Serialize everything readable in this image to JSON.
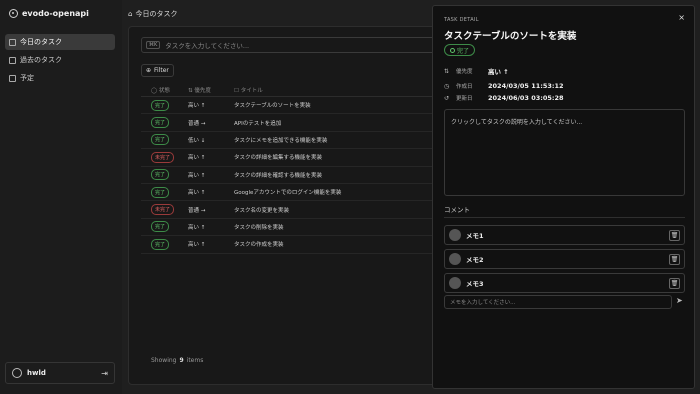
{
  "app": {
    "name": "evodo-openapi"
  },
  "sidebar": {
    "items": [
      {
        "label": "今日のタスク",
        "active": true
      },
      {
        "label": "過去のタスク",
        "active": false
      },
      {
        "label": "予定",
        "active": false
      }
    ],
    "user": {
      "name": "hwld"
    }
  },
  "header": {
    "title": "今日のタスク"
  },
  "main": {
    "search": {
      "shortcut": "⌘K",
      "placeholder": "タスクを入力してください..."
    },
    "filter_label": "Filter",
    "columns": {
      "status": "状態",
      "priority": "優先度",
      "title": "タイトル"
    },
    "rows": [
      {
        "status": "完了",
        "done": true,
        "priority": "高い",
        "arrow": "↑",
        "title": "タスクテーブルのソートを実装"
      },
      {
        "status": "完了",
        "done": true,
        "priority": "普通",
        "arrow": "→",
        "title": "APIのテストを追加"
      },
      {
        "status": "完了",
        "done": true,
        "priority": "低い",
        "arrow": "↓",
        "title": "タスクにメモを追加できる機能を実装"
      },
      {
        "status": "未完了",
        "done": false,
        "priority": "高い",
        "arrow": "↑",
        "title": "タスクの詳細を編集する機能を実装"
      },
      {
        "status": "完了",
        "done": true,
        "priority": "高い",
        "arrow": "↑",
        "title": "タスクの詳細を確認する機能を実装"
      },
      {
        "status": "完了",
        "done": true,
        "priority": "高い",
        "arrow": "↑",
        "title": "Googleアカウントでのログイン機能を実装"
      },
      {
        "status": "未完了",
        "done": false,
        "priority": "普通",
        "arrow": "→",
        "title": "タスク名の変更を実装"
      },
      {
        "status": "完了",
        "done": true,
        "priority": "高い",
        "arrow": "↑",
        "title": "タスクの削除を実装"
      },
      {
        "status": "完了",
        "done": true,
        "priority": "高い",
        "arrow": "↑",
        "title": "タスクの作成を実装"
      }
    ],
    "showing": {
      "prefix": "Showing",
      "count": "9",
      "suffix": "items"
    }
  },
  "detail": {
    "eyebrow": "TASK DETAIL",
    "close": "×",
    "title": "タスクテーブルのソートを実装",
    "status": "完了",
    "priority_label": "優先度",
    "priority_value": "高い ↑",
    "created_label": "作成日",
    "created_value": "2024/03/05 11:53:12",
    "updated_label": "更新日",
    "updated_value": "2024/06/03 03:05:28",
    "description_placeholder": "クリックしてタスクの説明を入力してください...",
    "comments_label": "コメント",
    "comments": [
      {
        "text": "メモ1"
      },
      {
        "text": "メモ2"
      },
      {
        "text": "メモ3"
      }
    ],
    "comment_placeholder": "メモを入力してください..."
  },
  "colors": {
    "done": "#5fc46a",
    "not_done": "#e06262",
    "panel": "#111111"
  }
}
